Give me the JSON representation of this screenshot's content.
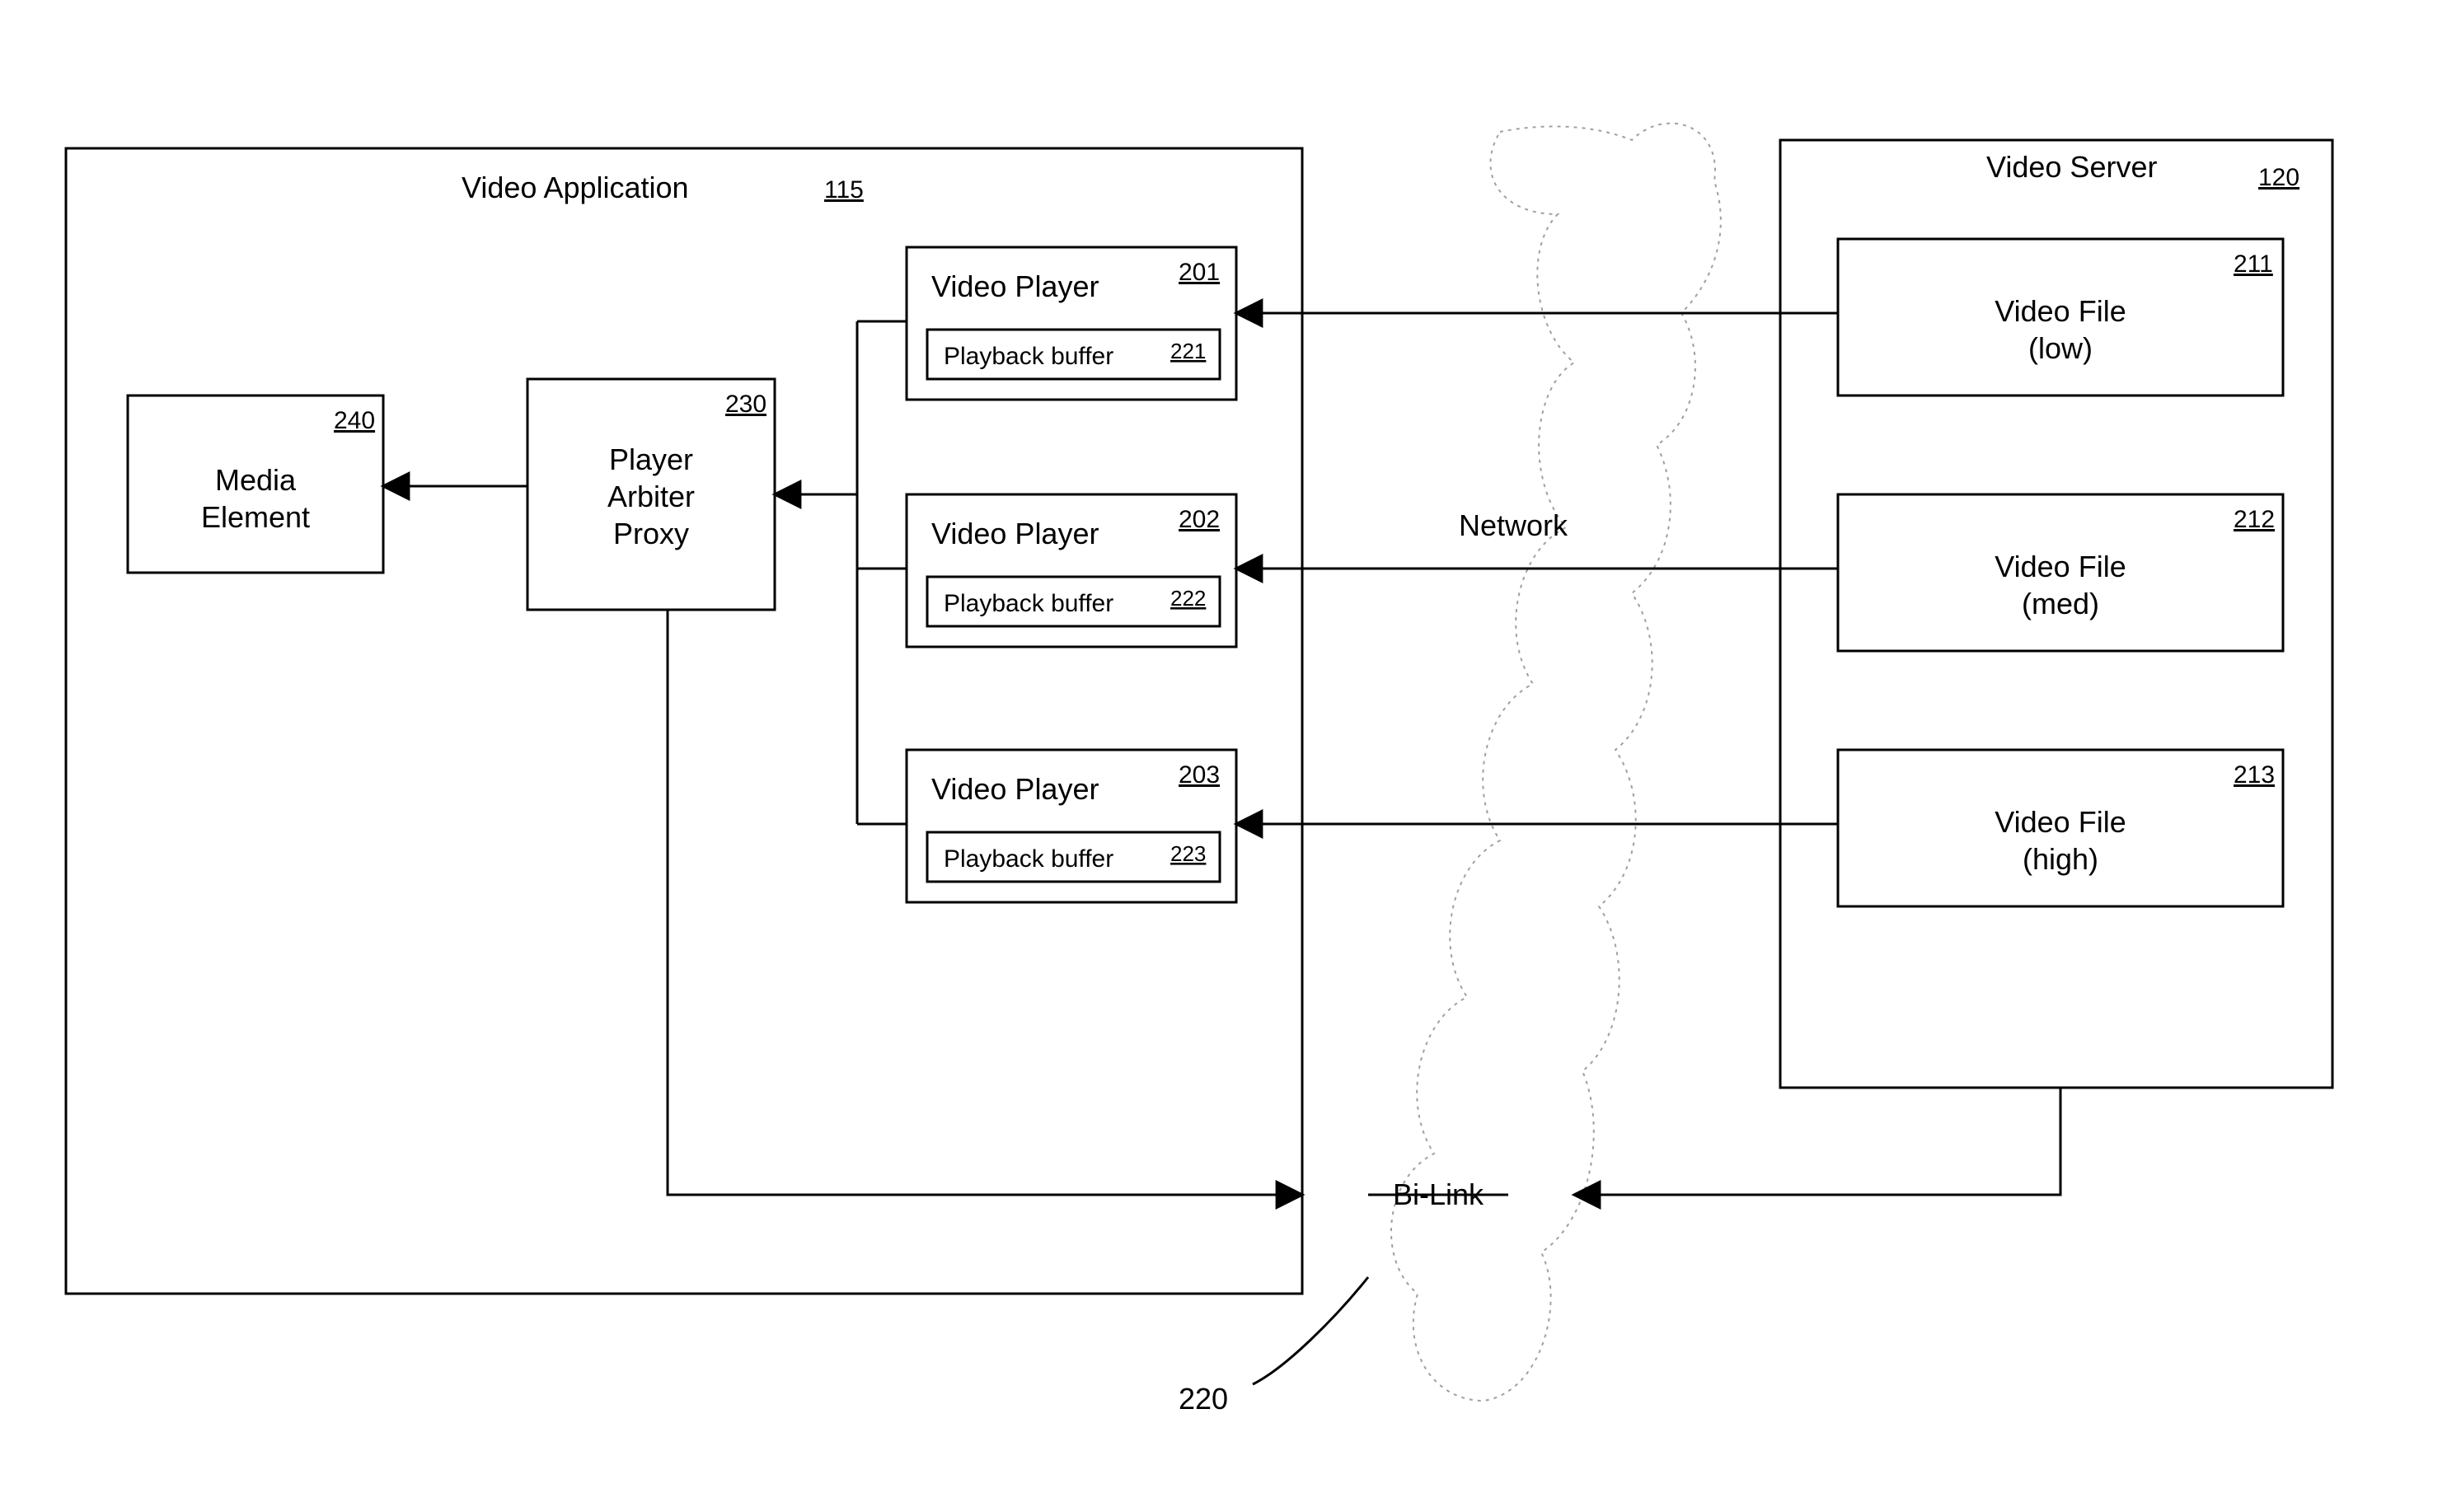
{
  "app": {
    "label": "Video Application",
    "ref": "115"
  },
  "server": {
    "label": "Video Server",
    "ref": "120"
  },
  "media": {
    "label1": "Media",
    "label2": "Element",
    "ref": "240"
  },
  "proxy": {
    "label1": "Player",
    "label2": "Arbiter",
    "label3": "Proxy",
    "ref": "230"
  },
  "players": [
    {
      "label": "Video Player",
      "ref": "201",
      "buf_label": "Playback buffer",
      "buf_ref": "221"
    },
    {
      "label": "Video Player",
      "ref": "202",
      "buf_label": "Playback buffer",
      "buf_ref": "222"
    },
    {
      "label": "Video Player",
      "ref": "203",
      "buf_label": "Playback buffer",
      "buf_ref": "223"
    }
  ],
  "files": [
    {
      "label1": "Video File",
      "label2": "(low)",
      "ref": "211"
    },
    {
      "label1": "Video File",
      "label2": "(med)",
      "ref": "212"
    },
    {
      "label1": "Video File",
      "label2": "(high)",
      "ref": "213"
    }
  ],
  "network": {
    "label": "Network"
  },
  "bilink": {
    "label": "Bi-Link",
    "ref": "220"
  }
}
